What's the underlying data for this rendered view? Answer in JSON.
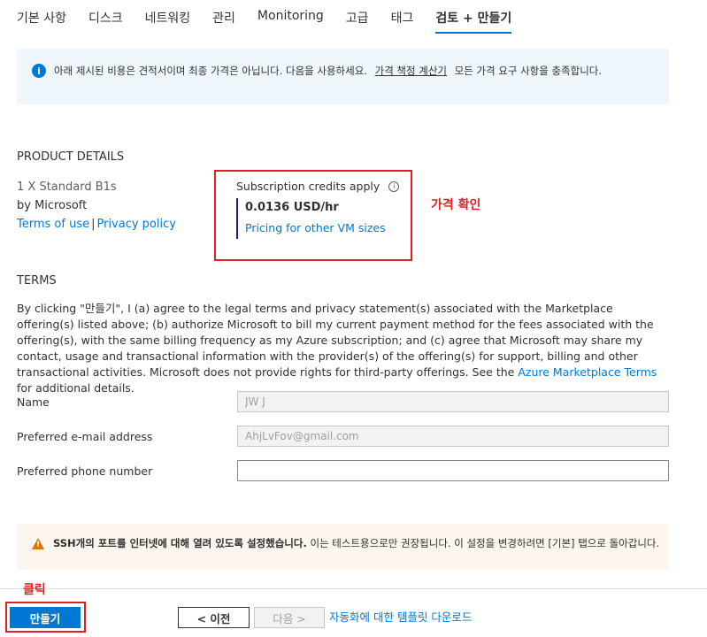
{
  "tabs": [
    {
      "label": "기본 사항"
    },
    {
      "label": "디스크"
    },
    {
      "label": "네트워킹"
    },
    {
      "label": "관리"
    },
    {
      "label": "Monitoring"
    },
    {
      "label": "고급"
    },
    {
      "label": "태그"
    },
    {
      "label": "검토 + 만들기",
      "active": true
    }
  ],
  "info_banner": {
    "text_before": "아래 제시된 비용은 견적서이며 최종 가격은 아닙니다. 다음을 사용하세요.",
    "link": "가격 책정 계산기",
    "text_after": "모든 가격 요구 사항을 충족합니다."
  },
  "product": {
    "section_title": "PRODUCT DETAILS",
    "name": "1 X Standard B1s",
    "by": "by Microsoft",
    "terms_link": "Terms of use",
    "separator": "|",
    "privacy_link": "Privacy policy",
    "credits_label": "Subscription credits apply",
    "price": "0.0136 USD/hr",
    "pricing_link": "Pricing for other VM sizes"
  },
  "annotations": {
    "price_check": "가격 확인",
    "click": "클릭"
  },
  "terms": {
    "section_title": "TERMS",
    "text_before": "By clicking \"만들기\", I (a) agree to the legal terms and privacy statement(s) associated with the Marketplace offering(s) listed above; (b) authorize Microsoft to bill my current payment method for the fees associated with the offering(s), with the same billing frequency as my Azure subscription; and (c) agree that Microsoft may share my contact, usage and transactional information with the provider(s) of the offering(s) for support, billing and other transactional activities. Microsoft does not provide rights for third-party offerings. See the",
    "link": "Azure Marketplace Terms",
    "text_after": "for additional details."
  },
  "form": {
    "name_label": "Name",
    "name_value": "JW J",
    "email_label": "Preferred e-mail address",
    "email_value": "AhjLvFov@gmail.com",
    "phone_label": "Preferred phone number",
    "phone_value": ""
  },
  "warning": {
    "bold_text": "SSH개의 포트를 인터넷에 대해 열려 있도록 설정했습니다.",
    "text": " 이는 테스트용으로만 권장됩니다.  이 설정을 변경하려면 [기본] 탭으로 돌아갑니다."
  },
  "footer": {
    "create_label": "만들기",
    "prev_label": "< 이전",
    "next_label": "다음 >",
    "download_link": "자동화에 대한 템플릿 다운로드"
  },
  "colors": {
    "accent": "#0078d4",
    "annotation_red": "#e02020",
    "info_bg": "#eff6fc",
    "warning_icon": "#d97706"
  }
}
